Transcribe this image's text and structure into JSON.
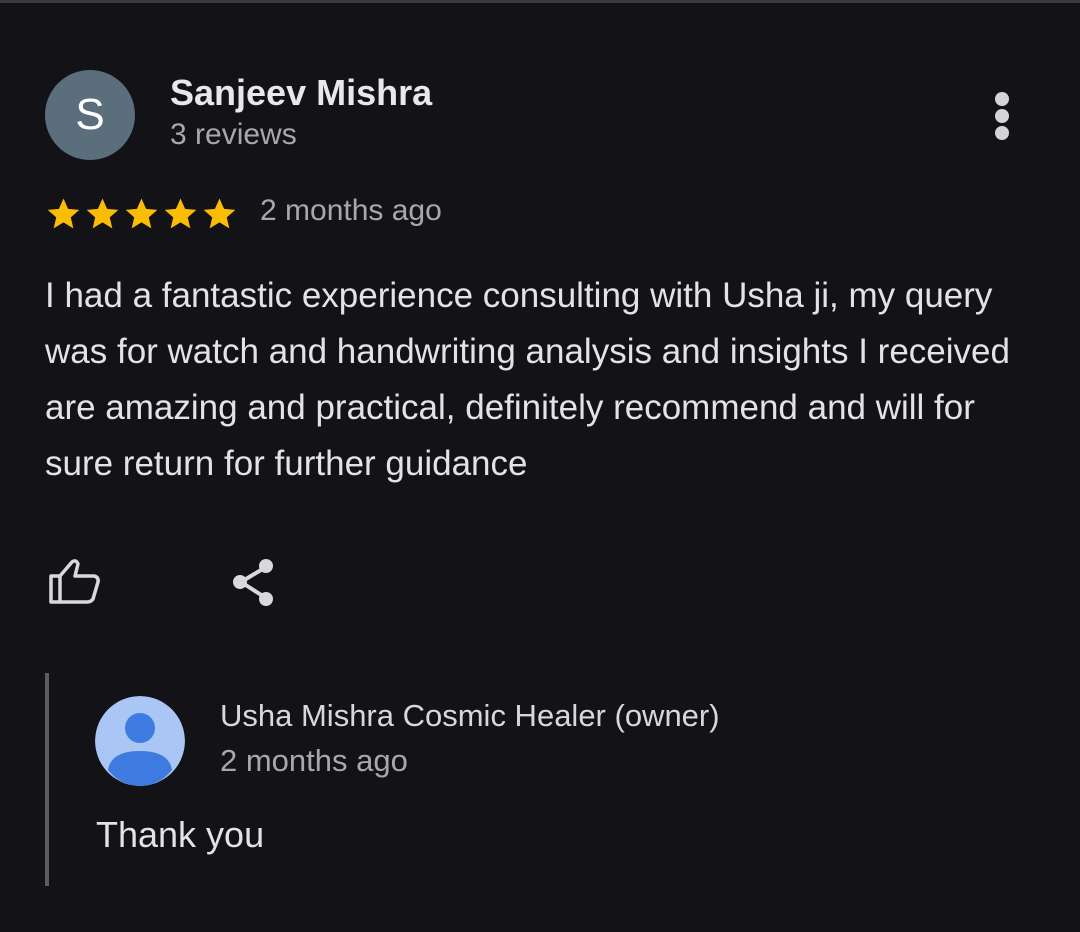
{
  "review": {
    "avatar_letter": "S",
    "avatar_color": "#5b6e7b",
    "reviewer_name": "Sanjeev Mishra",
    "review_count": "3 reviews",
    "rating": 5,
    "rating_max": 5,
    "star_color": "#fbbc04",
    "date": "2 months ago",
    "text": "I had a fantastic experience consulting with Usha ji, my query was for watch and handwriting analysis and insights I received are amazing and practical, definitely recommend and will for sure return for further guidance",
    "more_icon": "more-vert-icon",
    "actions": {
      "like_icon": "thumb-up-icon",
      "share_icon": "share-icon"
    }
  },
  "reply": {
    "owner_name": "Usha Mishra Cosmic Healer (owner)",
    "date": "2 months ago",
    "text": "Thank you",
    "avatar_icon": "default-profile-icon",
    "avatar_color": "#4a86e8"
  }
}
